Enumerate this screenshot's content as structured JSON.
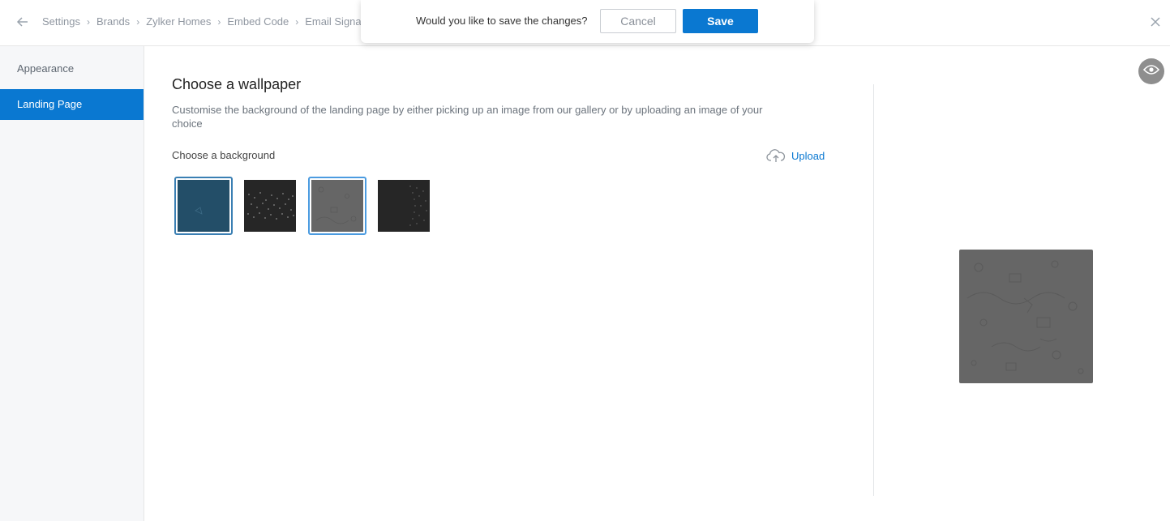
{
  "breadcrumb": [
    "Settings",
    "Brands",
    "Zylker Homes",
    "Embed Code",
    "Email Signatur"
  ],
  "confirm": {
    "message": "Would you like to save the changes?",
    "cancel_label": "Cancel",
    "save_label": "Save"
  },
  "sidebar": {
    "items": [
      {
        "label": "Appearance",
        "active": false
      },
      {
        "label": "Landing Page",
        "active": true
      }
    ]
  },
  "main": {
    "title": "Choose a wallpaper",
    "description": "Customise the background of the landing page by either picking up an image from our gallery or by uploading an image of your choice",
    "background_label": "Choose a background",
    "upload_label": "Upload"
  },
  "wallpapers": [
    {
      "name": "teal",
      "color": "#234e68",
      "selected": false
    },
    {
      "name": "dots",
      "color": "#262626",
      "selected": false
    },
    {
      "name": "doodle-grey",
      "color": "#666666",
      "selected": true
    },
    {
      "name": "dark-arc",
      "color": "#262626",
      "selected": false
    }
  ],
  "colors": {
    "accent": "#0a78d1",
    "sidebar_bg": "#f6f7f9"
  },
  "icons": {
    "back": "arrow-left-icon",
    "close": "close-icon",
    "upload": "cloud-upload-icon",
    "preview": "eye-icon"
  }
}
